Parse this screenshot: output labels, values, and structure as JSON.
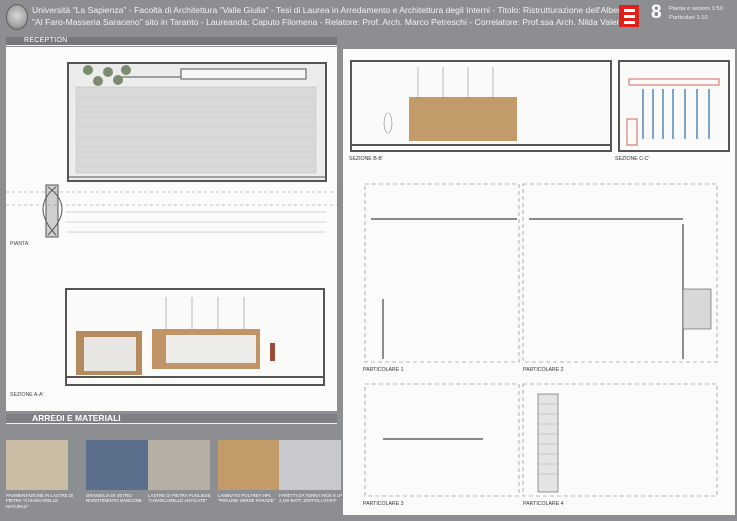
{
  "header": {
    "line1": "Università \"La Sapienza\" - Facoltà di Architettura \"Valle Giulia\" - Tesi di Laurea in Arredamento e Architettura degli Interni - Titolo: Ristrutturazione dell'Albergo",
    "line2": "\"Al Faro-Masseria Saraceno\" sito in Taranto - Laureanda: Caputo Filomena - Relatore: Prof. Arch. Marco Petreschi - Correlatore: Prof.ssa Arch. Nilda Valentin",
    "page_number": "8",
    "scale_line1": "Pianta e sezioni 1:50",
    "scale_line2": "Particolari 1:10",
    "logo_icon": "red-square-logo",
    "seal_icon": "university-seal"
  },
  "sections": {
    "reception": "RECEPTION",
    "materials": "ARREDI E MATERIALI"
  },
  "drawings": {
    "pianta": "PIANTA",
    "sezione_aa": "SEZIONE A-A'",
    "sezione_bb": "SEZIONE B-B'",
    "sezione_cc": "SEZIONE C-C'",
    "particolare1": "PARTICOLARE 1",
    "particolare2": "PARTICOLARE 2",
    "particolare3": "PARTICOLARE 3",
    "particolare4": "PARTICOLARE 4"
  },
  "materials": [
    {
      "caption": "PAVIMENTAZIONE IN LASTRE DI PIETRA \"CHIANCARELLE NATURALI\"",
      "color": "#c9bda6"
    },
    {
      "caption": "GRANIGLIA DI VETRO RIVESTIMENTO BANCONE",
      "color": "#5b6e8c"
    },
    {
      "caption": "LASTRE DI PIETRA PUGLIESE \"CHIANCARELLE ANTICATE\"",
      "color": "#b6b0a4"
    },
    {
      "caption": "LAMINATO POLYREY HPL \"PRALINE VERDE PARADE\"",
      "color": "#c39a6a"
    },
    {
      "caption": "FARETTI DA TERRA INOX 8 LP 2,1W BATT. ZOFFOLI STAFF",
      "color": "#c7c9cc"
    }
  ]
}
